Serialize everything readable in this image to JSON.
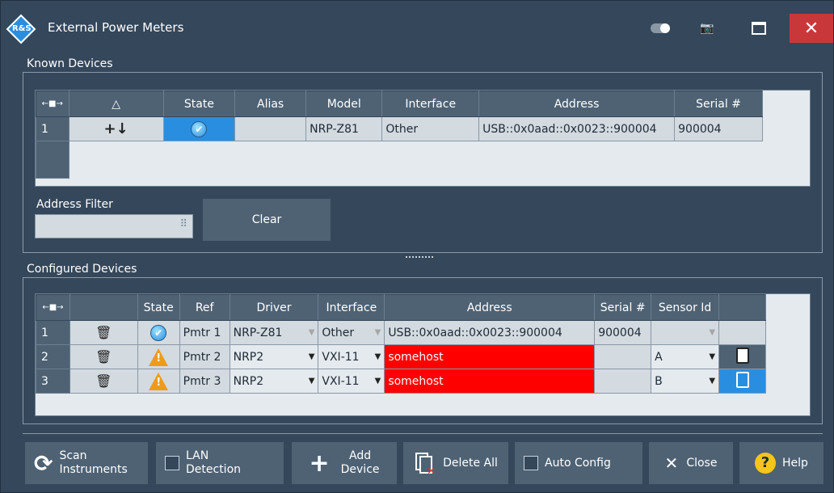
{
  "window": {
    "title": "External Power Meters",
    "close_glyph": "✕",
    "camera_glyph": "📷"
  },
  "known": {
    "label": "Known Devices",
    "headers": [
      "←■→",
      "△",
      "State",
      "Alias",
      "Model",
      "Interface",
      "Address",
      "Serial #"
    ],
    "rows": [
      {
        "num": "1",
        "add_glyph": "+↓",
        "state_glyph": "✔",
        "alias": "",
        "model": "NRP-Z81",
        "interface": "Other",
        "address": "USB::0x0aad::0x0023::900004",
        "serial": "900004"
      }
    ],
    "address_filter_label": "Address Filter",
    "clear_label": "Clear"
  },
  "configured": {
    "label": "Configured Devices",
    "headers": [
      "←■→",
      "",
      "State",
      "Ref",
      "Driver",
      "Interface",
      "Address",
      "Serial #",
      "Sensor Id",
      ""
    ],
    "rows": [
      {
        "num": "1",
        "trash_glyph": "🗑",
        "state_glyph": "✔",
        "ref": "Pmtr 1",
        "driver": "NRP-Z81",
        "interface": "Other",
        "address": "USB::0x0aad::0x0023::900004",
        "serial": "900004",
        "sensor": ""
      },
      {
        "num": "2",
        "trash_glyph": "🗑",
        "state_glyph": "!",
        "ref": "Pmtr 2",
        "driver": "NRP2",
        "interface": "VXI-11",
        "address": "somehost",
        "serial": "",
        "sensor": "A"
      },
      {
        "num": "3",
        "trash_glyph": "🗑",
        "state_glyph": "!",
        "ref": "Pmtr 3",
        "driver": "NRP2",
        "interface": "VXI-11",
        "address": "somehost",
        "serial": "",
        "sensor": "B"
      }
    ]
  },
  "footer": {
    "scan": {
      "line1": "Scan",
      "line2": "Instruments",
      "glyph": "⟳"
    },
    "lan": {
      "line1": "LAN",
      "line2": "Detection"
    },
    "add": {
      "line1": "Add",
      "line2": "Device",
      "glyph": "+"
    },
    "delete_all": "Delete All",
    "auto_config": "Auto Config",
    "close": "Close",
    "close_glyph": "✕",
    "help": "Help",
    "help_glyph": "?"
  },
  "colors": {
    "background": "#35475a",
    "header": "#4e6274",
    "error": "#ff0000",
    "accent": "#2a8ee0",
    "close": "#c8383b"
  }
}
